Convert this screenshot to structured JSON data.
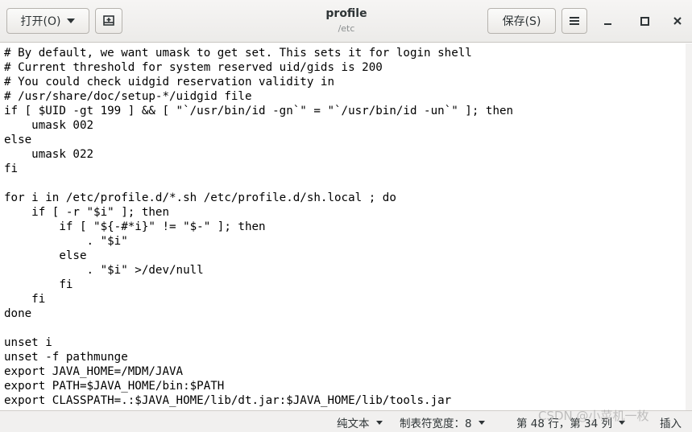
{
  "header": {
    "open_label": "打开(O)",
    "save_label": "保存(S)",
    "title": "profile",
    "subtitle": "/etc"
  },
  "editor": {
    "lines": [
      "# By default, we want umask to get set. This sets it for login shell",
      "# Current threshold for system reserved uid/gids is 200",
      "# You could check uidgid reservation validity in",
      "# /usr/share/doc/setup-*/uidgid file",
      "if [ $UID -gt 199 ] && [ \"`/usr/bin/id -gn`\" = \"`/usr/bin/id -un`\" ]; then",
      "    umask 002",
      "else",
      "    umask 022",
      "fi",
      "",
      "for i in /etc/profile.d/*.sh /etc/profile.d/sh.local ; do",
      "    if [ -r \"$i\" ]; then",
      "        if [ \"${-#*i}\" != \"$-\" ]; then",
      "            . \"$i\"",
      "        else",
      "            . \"$i\" >/dev/null",
      "        fi",
      "    fi",
      "done",
      "",
      "unset i",
      "unset -f pathmunge",
      "export JAVA_HOME=/MDM/JAVA",
      "export PATH=$JAVA_HOME/bin:$PATH",
      "export CLASSPATH=.:$JAVA_HOME/lib/dt.jar:$JAVA_HOME/lib/tools.jar"
    ]
  },
  "status": {
    "language": "纯文本",
    "tab_width": "制表符宽度：8",
    "position": "第 48 行，第 34 列",
    "mode": "插入"
  },
  "watermark": "CSDN @小菜机一枚",
  "icons": {
    "open_menu": "chevron-down-icon",
    "new_document": "new-document-icon",
    "hamburger": "menu-icon",
    "minimize": "minimize-icon",
    "maximize": "maximize-icon",
    "close": "close-icon"
  }
}
